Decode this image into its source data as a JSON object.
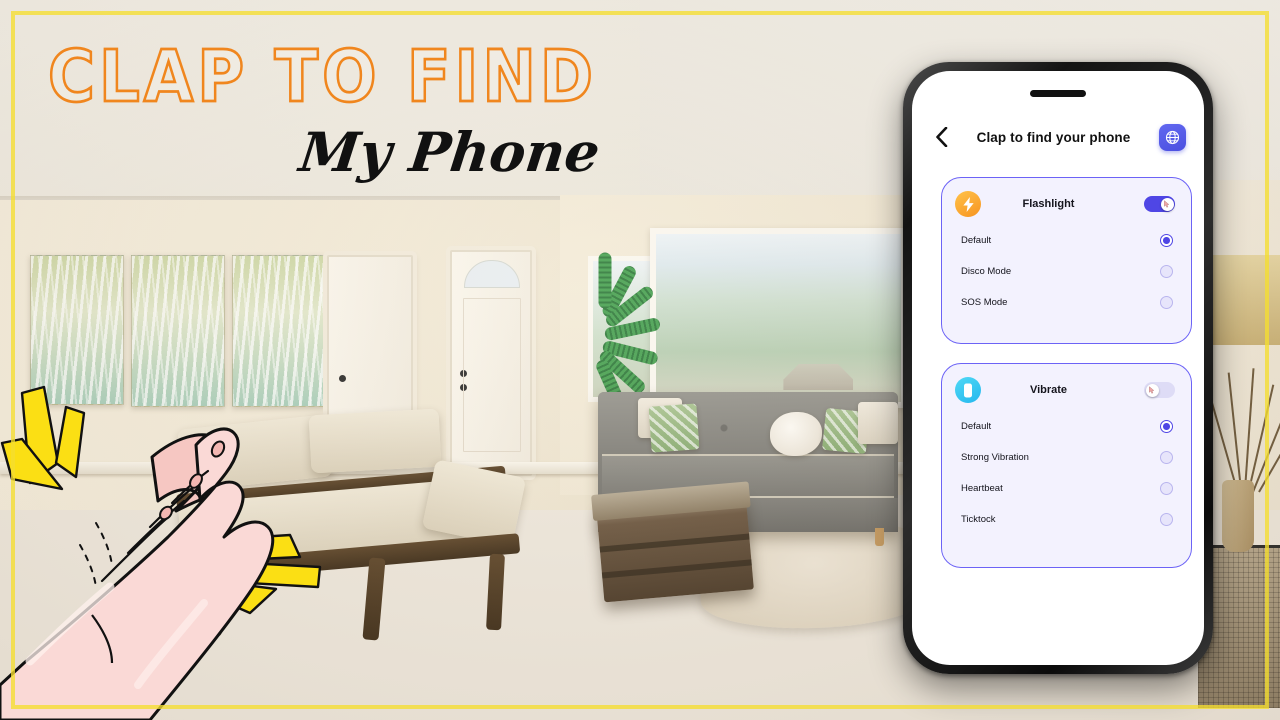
{
  "promo": {
    "headline": "CLAP TO FIND",
    "subhead": "My Phone",
    "headline_stroke_color": "#F0861E",
    "frame_color": "#F5DE30",
    "spark_color": "#FBDF14"
  },
  "scene": {
    "description": "living-room-photo-background",
    "hands_illustration": "clapping-hands"
  },
  "phone": {
    "header": {
      "back_icon": "chevron-left-icon",
      "title": "Clap to find your phone",
      "language_icon": "globe-icon",
      "language_button_color": "#4F46E5"
    },
    "cards": [
      {
        "id": "flashlight",
        "icon": "lightning-bolt-icon",
        "icon_color": "#F79420",
        "title": "Flashlight",
        "toggle_state": "on",
        "options": [
          {
            "label": "Default",
            "selected": true
          },
          {
            "label": "Disco Mode",
            "selected": false
          },
          {
            "label": "SOS Mode",
            "selected": false
          }
        ]
      },
      {
        "id": "vibrate",
        "icon": "phone-vibrate-icon",
        "icon_color": "#25B8EE",
        "title": "Vibrate",
        "toggle_state": "off",
        "options": [
          {
            "label": "Default",
            "selected": true
          },
          {
            "label": "Strong Vibration",
            "selected": false
          },
          {
            "label": "Heartbeat",
            "selected": false
          },
          {
            "label": "Ticktock",
            "selected": false
          }
        ]
      }
    ],
    "accent_color": "#6C63F6",
    "card_background": "#F3F2FE"
  }
}
